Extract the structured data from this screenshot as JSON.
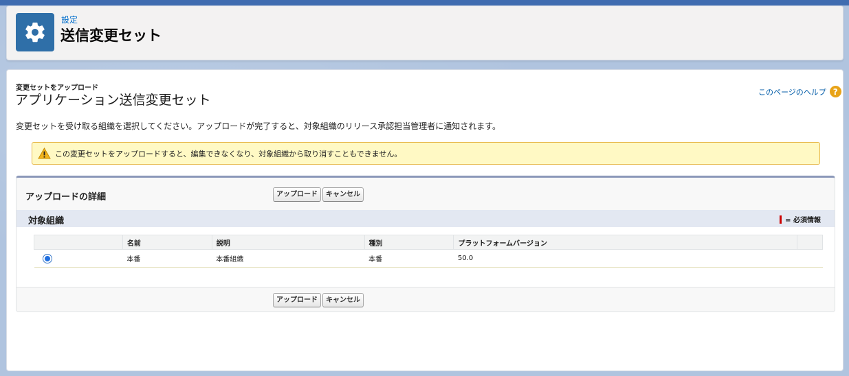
{
  "header": {
    "breadcrumb": "設定",
    "title": "送信変更セット",
    "icon": "gear-icon"
  },
  "page": {
    "description": "変更セットをアップロード",
    "title": "アプリケーション送信変更セット",
    "help_link": "このページのヘルプ",
    "help_icon": "?",
    "intro": "変更セットを受け取る組織を選択してください。アップロードが完了すると、対象組織のリリース承認担当管理者に通知されます。"
  },
  "warning": {
    "icon": "warning-icon",
    "text": "この変更セットをアップロードすると、編集できなくなり、対象組織から取り消すこともできません。"
  },
  "upload_section": {
    "title": "アップロードの詳細",
    "upload_label": "アップロード",
    "cancel_label": "キャンセル",
    "subsection_title": "対象組織",
    "required_legend": "= 必須情報"
  },
  "table": {
    "columns": [
      "",
      "名前",
      "説明",
      "種別",
      "プラットフォームバージョン",
      ""
    ],
    "rows": [
      {
        "selected": true,
        "name": "本番",
        "description": "本番組織",
        "type": "本番",
        "platform_version": "50.0"
      }
    ]
  },
  "colors": {
    "accent": "#2f6fa8",
    "link": "#006dcc",
    "warning_bg": "#fff9c4",
    "warning_border": "#e7b84a",
    "required": "#cc0000"
  }
}
